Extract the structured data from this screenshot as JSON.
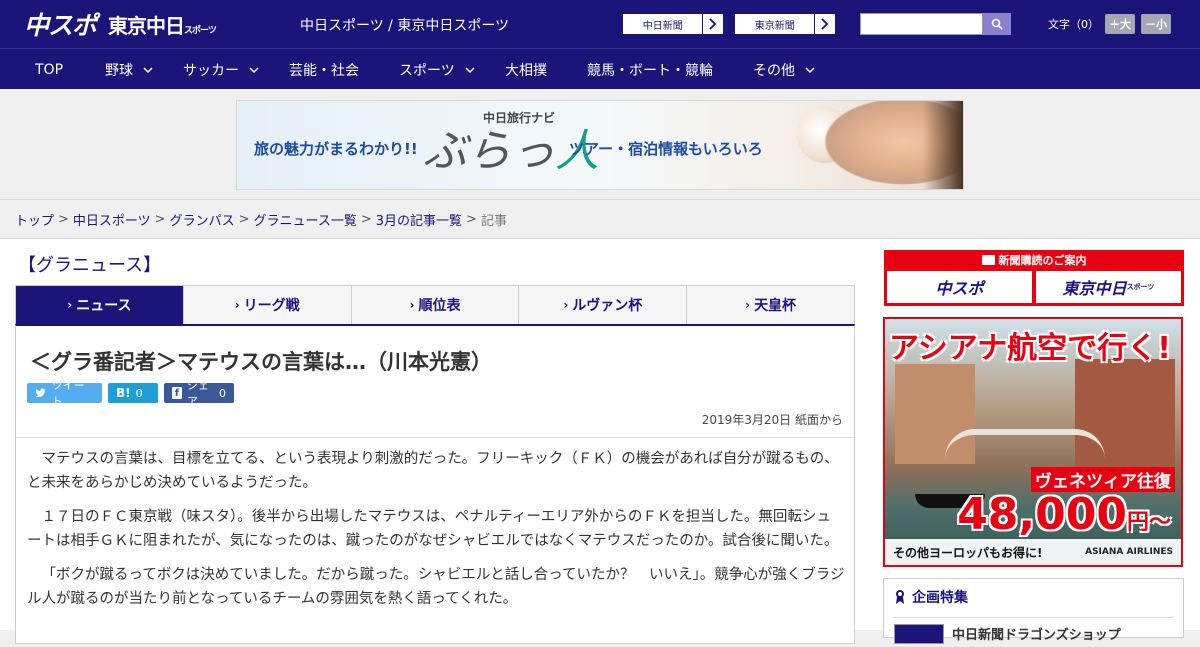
{
  "header": {
    "logo_chuspo": "中スポ",
    "logo_tokyo": "東京中日",
    "logo_tokyo_small": "スポーツ",
    "site_name": "中日スポーツ / 東京中日スポーツ",
    "ext_links": [
      "中日新聞",
      "東京新聞"
    ],
    "search_placeholder": "",
    "font_size_label": "文字（0）",
    "font_larger": "＋大",
    "font_smaller": "－小"
  },
  "nav": {
    "items": [
      {
        "label": "TOP",
        "dropdown": false
      },
      {
        "label": "野球",
        "dropdown": true
      },
      {
        "label": "サッカー",
        "dropdown": true
      },
      {
        "label": "芸能・社会",
        "dropdown": false
      },
      {
        "label": "スポーツ",
        "dropdown": true
      },
      {
        "label": "大相撲",
        "dropdown": false
      },
      {
        "label": "競馬・ボート・競輪",
        "dropdown": false
      },
      {
        "label": "その他",
        "dropdown": true
      }
    ]
  },
  "banner": {
    "left_text": "旅の魅力がまるわかり!!",
    "navi_label": "中日旅行ナビ",
    "logo_text_a": "ぶらっ",
    "logo_text_b": "人",
    "right_text": "ツアー・宿泊情報もいろいろ"
  },
  "breadcrumb": [
    {
      "label": "トップ",
      "link": true
    },
    {
      "label": "中日スポーツ",
      "link": true
    },
    {
      "label": "グランパス",
      "link": true
    },
    {
      "label": "グラニュース一覧",
      "link": true
    },
    {
      "label": "3月の記事一覧",
      "link": true
    },
    {
      "label": "記事",
      "link": false
    }
  ],
  "section_title": "【グラニュース】",
  "tabs": [
    {
      "label": "ニュース",
      "active": true
    },
    {
      "label": "リーグ戦",
      "active": false
    },
    {
      "label": "順位表",
      "active": false
    },
    {
      "label": "ルヴァン杯",
      "active": false
    },
    {
      "label": "天皇杯",
      "active": false
    }
  ],
  "article": {
    "title": "＜グラ番記者＞マテウスの言葉は…（川本光憲）",
    "share": {
      "tweet": "ツイート",
      "hatena_count": "0",
      "facebook": "シェア",
      "facebook_count": "0"
    },
    "date": "2019年3月20日 紙面から",
    "paragraphs": [
      "マテウスの言葉は、目標を立てる、という表現より刺激的だった。フリーキック（ＦＫ）の機会があれば自分が蹴るもの、と未来をあらかじめ決めているようだった。",
      "１７日のＦＣ東京戦（味スタ）。後半から出場したマテウスは、ペナルティーエリア外からのＦＫを担当した。無回転シュートは相手ＧＫに阻まれたが、気になったのは、蹴ったのがなぜシャビエルではなくマテウスだったのか。試合後に聞いた。",
      "「ボクが蹴るってボクは決めていました。だから蹴った。シャビエルと話し合っていたか？　いいえ」。競争心が強くブラジル人が蹴るのが当たり前となっているチームの雰囲気を熱く語ってくれた。"
    ]
  },
  "sidebar": {
    "subscribe_head": "新聞購読のご案内",
    "subscribe_logos": [
      "中スポ",
      "東京中日"
    ],
    "subscribe_logo_small": "スポーツ",
    "ad": {
      "title": "アシアナ航空で行く!",
      "route": "ヴェネツィア往復",
      "price": "48,000",
      "price_unit": "円〜",
      "footer": "その他ヨーロッパもお得に!",
      "brand": "ASIANA AIRLINES"
    },
    "feature_head": "企画特集",
    "feature_item": "中日新聞ドラゴンズショップ"
  }
}
